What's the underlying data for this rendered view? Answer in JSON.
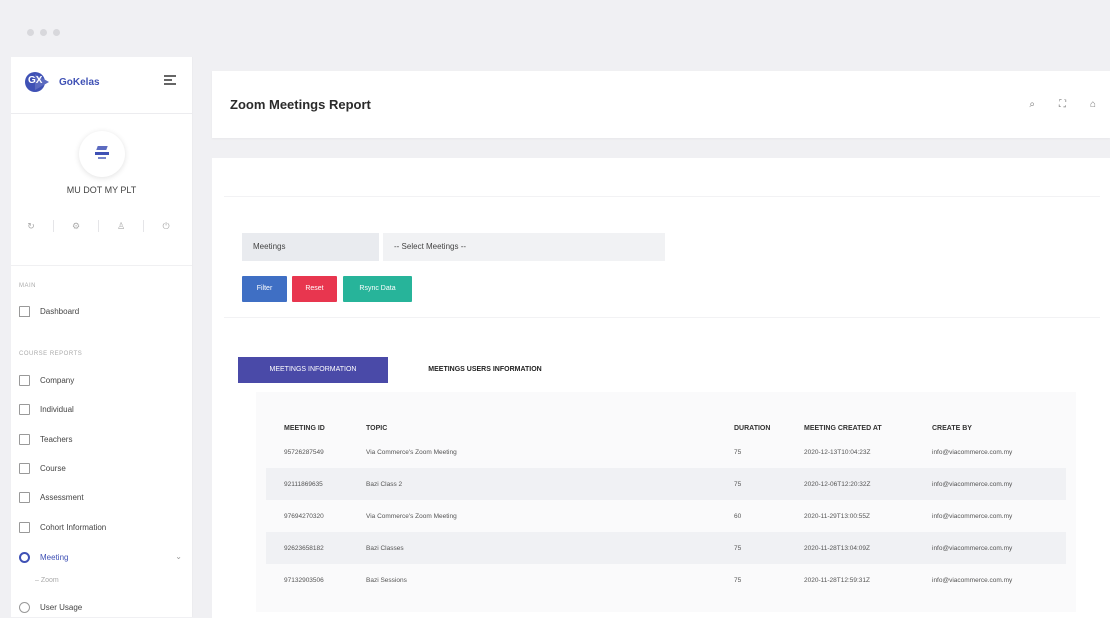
{
  "sidebar": {
    "brand": "GoKelas",
    "company_name": "MU DOT MY PLT",
    "section_main": "MAIN",
    "section_reports": "COURSE REPORTS",
    "items": [
      {
        "label": "Dashboard"
      },
      {
        "label": "Company"
      },
      {
        "label": "Individual"
      },
      {
        "label": "Teachers"
      },
      {
        "label": "Course"
      },
      {
        "label": "Assessment"
      },
      {
        "label": "Cohort Information"
      },
      {
        "label": "Meeting"
      },
      {
        "label": "User Usage"
      }
    ],
    "sub_items": [
      {
        "label": "Zoom"
      }
    ]
  },
  "header": {
    "title": "Zoom Meetings Report"
  },
  "filters": {
    "label": "Meetings",
    "select_value": "-- Select Meetings --",
    "filter_button": "Filter",
    "reset_button": "Reset",
    "sync_button": "Rsync Data"
  },
  "tabs": [
    {
      "label": "MEETINGS INFORMATION"
    },
    {
      "label": "MEETINGS USERS INFORMATION"
    }
  ],
  "table": {
    "columns": [
      "MEETING ID",
      "TOPIC",
      "DURATION",
      "MEETING CREATED AT",
      "CREATE BY"
    ],
    "rows": [
      [
        "95726287549",
        "Via Commerce's Zoom Meeting",
        "75",
        "2020-12-13T10:04:23Z",
        "info@viacommerce.com.my"
      ],
      [
        "92111869635",
        "Bazi Class 2",
        "75",
        "2020-12-06T12:20:32Z",
        "info@viacommerce.com.my"
      ],
      [
        "97694270320",
        "Via Commerce's Zoom Meeting",
        "60",
        "2020-11-29T13:00:55Z",
        "info@viacommerce.com.my"
      ],
      [
        "92623658182",
        "Bazi Classes",
        "75",
        "2020-11-28T13:04:09Z",
        "info@viacommerce.com.my"
      ],
      [
        "97132903506",
        "Bazi Sessions",
        "75",
        "2020-11-28T12:59:31Z",
        "info@viacommerce.com.my"
      ]
    ]
  }
}
